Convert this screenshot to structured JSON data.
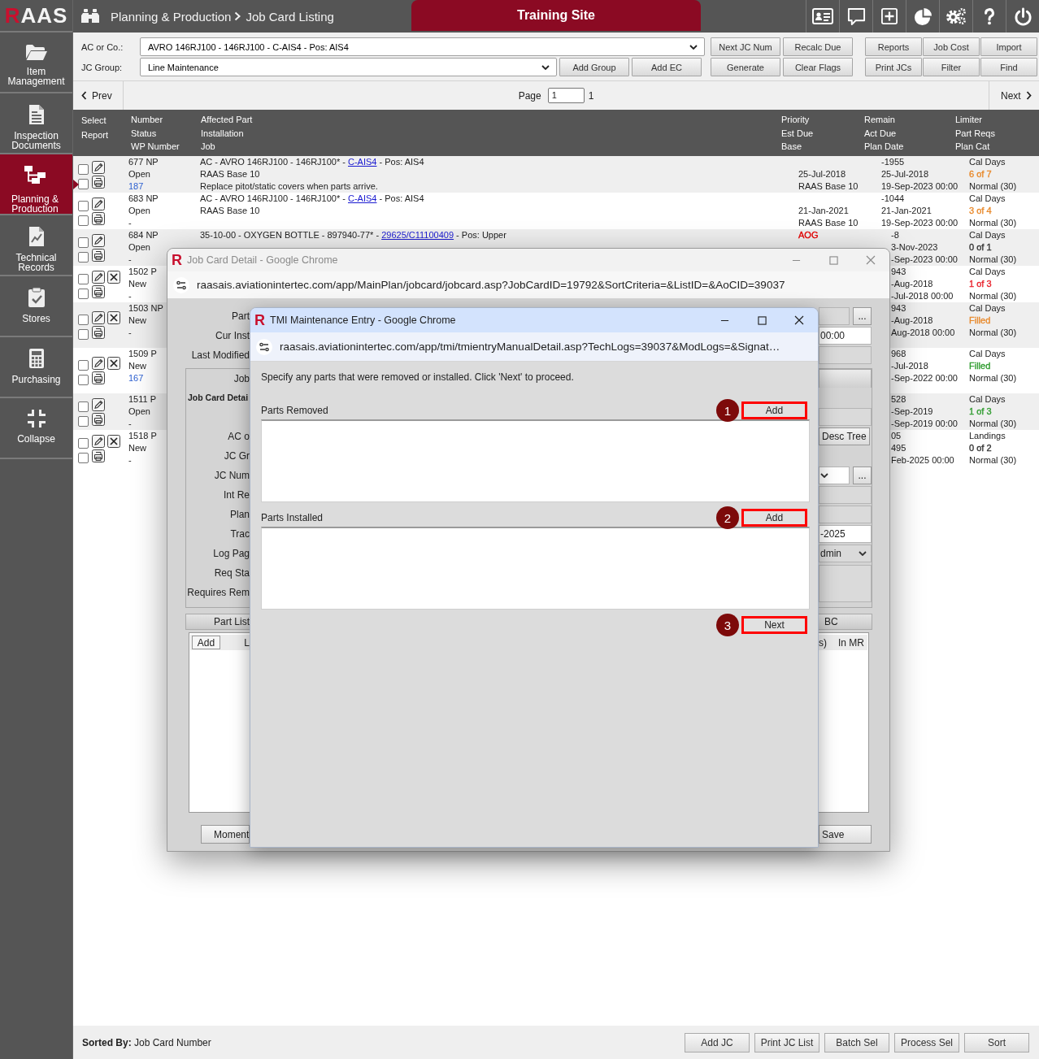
{
  "app": {
    "logo": "RAAS",
    "breadcrumb": [
      "Planning & Production",
      "Job Card Listing"
    ],
    "site_banner": "Training Site"
  },
  "sidebar": {
    "items": [
      {
        "label": "Item Management",
        "selected": false
      },
      {
        "label": "Inspection Documents",
        "selected": false
      },
      {
        "label": "Planning & Production",
        "selected": true
      },
      {
        "label": "Technical Records",
        "selected": false
      },
      {
        "label": "Stores",
        "selected": false
      },
      {
        "label": "Purchasing",
        "selected": false
      },
      {
        "label": "Collapse",
        "selected": false
      }
    ]
  },
  "filters": {
    "aircraft": {
      "label": "AC or Co.:",
      "value": "AVRO 146RJ100 - 146RJ100 - C-AIS4 - Pos: AIS4"
    },
    "group": {
      "label": "JC Group:",
      "value": "Line Maintenance",
      "buttons": [
        "Add Group",
        "Add EC"
      ]
    }
  },
  "action_buttons": [
    [
      "Next JC Num",
      "Recalc Due"
    ],
    [
      "Generate",
      "Clear Flags"
    ]
  ],
  "report_buttons": [
    [
      "Reports",
      "Job Cost",
      "Import"
    ],
    [
      "Print JCs",
      "Filter",
      "Find"
    ]
  ],
  "pager": {
    "prev": "Prev",
    "page_label": "Page",
    "page": "1",
    "page_count": "1",
    "next": "Next"
  },
  "table": {
    "columns": [
      [
        "Select",
        "Report"
      ],
      [
        "Number",
        "Status",
        "WP Number"
      ],
      [
        "Affected Part",
        "Installation",
        "Job"
      ],
      [
        "Priority",
        "Est Due",
        "Base"
      ],
      [
        "Remain",
        "Act Due",
        "Plan Date"
      ],
      [
        "Limiter",
        "Part Reqs",
        "Plan Cat"
      ]
    ],
    "rows": [
      {
        "number": "677 NP",
        "status": "Open",
        "wp": {
          "text": "187",
          "link": true
        },
        "part": {
          "before": "AC - AVRO 146RJ100 - 146RJ100* - ",
          "link": "C-AIS4",
          "after": " - Pos: AIS4"
        },
        "installation": "RAAS Base 10",
        "job": "Replace pitot/static covers when parts arrive.",
        "est_due": "25-Jul-2018",
        "base": "RAAS Base 10",
        "remain": "-1955",
        "act_due": "25-Jul-2018",
        "plan_date": "19-Sep-2023 00:00",
        "limiter": "Cal Days",
        "part_reqs": {
          "text": "6 of 7",
          "color": "#e8892b"
        },
        "plan_cat": "Normal (30)",
        "select_checked": false,
        "report_checked": false,
        "deletable": false
      },
      {
        "number": "683 NP",
        "status": "Open",
        "wp": {
          "text": "-",
          "link": false
        },
        "part": {
          "before": "AC - AVRO 146RJ100 - 146RJ100* - ",
          "link": "C-AIS4",
          "after": " - Pos: AIS4"
        },
        "installation": "RAAS Base 10",
        "est_due": "21-Jan-2021",
        "base": "RAAS Base 10",
        "remain": "-1044",
        "act_due": "21-Jan-2021",
        "plan_date": "19-Sep-2023 00:00",
        "limiter": "Cal Days",
        "part_reqs": {
          "text": "3 of 4",
          "color": "#e8892b"
        },
        "plan_cat": "Normal (30)",
        "select_checked": false,
        "report_checked": false,
        "deletable": false
      },
      {
        "number": "684 NP",
        "status": "Open",
        "wp": {
          "text": "-",
          "link": false
        },
        "part": {
          "before": "35-10-00 - OXYGEN BOTTLE - 897940-77* - ",
          "link": "29625/C11100409",
          "after": " - Pos: Upper"
        },
        "priority": {
          "text": "AOG",
          "color": "#e60000"
        },
        "remain": "-8",
        "act_due": "3-Nov-2023",
        "plan_date": "-Sep-2023 00:00",
        "limiter": "Cal Days",
        "part_reqs": {
          "text": "0 of 1",
          "color": "#333333"
        },
        "plan_cat": "Normal (30)",
        "select_checked": false,
        "report_checked": false,
        "deletable": false
      },
      {
        "number": "1502 P",
        "status": "New",
        "wp": {
          "text": "-",
          "link": false
        },
        "remain": "943",
        "act_due": "-Aug-2018",
        "plan_date": "-Jul-2018 00:00",
        "limiter": "Cal Days",
        "part_reqs": {
          "text": "1 of 3",
          "color": "#e8202a"
        },
        "plan_cat": "Normal (30)",
        "select_checked": false,
        "report_checked": false,
        "deletable": true
      },
      {
        "number": "1503 NP",
        "status": "New",
        "wp": {
          "text": "-",
          "link": false
        },
        "remain": "943",
        "act_due": "-Aug-2018",
        "plan_date": "Aug-2018 00:00",
        "limiter": "Cal Days",
        "part_reqs": {
          "text": "Filled",
          "color": "#e8892b"
        },
        "plan_cat": "Normal (30)",
        "select_checked": false,
        "report_checked": false,
        "deletable": true
      },
      {
        "number": "1509 P",
        "status": "New",
        "wp": {
          "text": "167",
          "link": true
        },
        "remain": "968",
        "act_due": "-Jul-2018",
        "plan_date": "-Sep-2022 00:00",
        "limiter": "Cal Days",
        "part_reqs": {
          "text": "Filled",
          "color": "#2e9b2e"
        },
        "plan_cat": "Normal (30)",
        "select_checked": false,
        "report_checked": false,
        "deletable": true
      },
      {
        "number": "1511 P",
        "status": "Open",
        "wp": {
          "text": "-",
          "link": false
        },
        "remain": "528",
        "act_due": "-Sep-2019",
        "plan_date": "-Sep-2019 00:00",
        "limiter": "Cal Days",
        "part_reqs": {
          "text": "1 of 3",
          "color": "#2e9b2e"
        },
        "plan_cat": "Normal (30)",
        "select_checked": false,
        "report_checked": false,
        "deletable": false
      },
      {
        "number": "1518 P",
        "status": "New",
        "wp": {
          "text": "-",
          "link": false
        },
        "remain": "05",
        "act_due": "495",
        "plan_date": "Feb-2025 00:00",
        "limiter": "Landings",
        "part_reqs": {
          "text": "0 of 2",
          "color": "#333333"
        },
        "plan_cat": "Normal (30)",
        "select_checked": false,
        "report_checked": false,
        "deletable": true
      }
    ]
  },
  "job_card_window": {
    "app_icon": "R",
    "title": "Job Card Detail - Google Chrome",
    "active": false,
    "url": "raasais.aviationintertec.com/app/MainPlan/jobcard/jobcard.asp?JobCardID=19792&SortCriteria=&ListID=&AoCID=39037",
    "fields": [
      {
        "label": "Part",
        "control": {
          "kind": "lookup",
          "button": "..."
        }
      },
      {
        "label": "Cur Inst",
        "control": {
          "kind": "input",
          "value": "00:00"
        }
      },
      {
        "label": "Last Modified",
        "control": {
          "kind": "readonly"
        }
      }
    ],
    "panel": {
      "header": "Job",
      "rows": [
        {
          "kind": "section",
          "label": "Job Card Detai"
        },
        {
          "kind": "field",
          "control": {
            "kind": "readonly"
          }
        },
        {
          "kind": "field",
          "label": "AC o",
          "control": {
            "kind": "button",
            "text": "Desc Tree"
          }
        },
        {
          "kind": "field",
          "label": "JC Gr"
        },
        {
          "kind": "field",
          "label": "JC Num",
          "control": {
            "kind": "lookup_select",
            "button": "..."
          }
        },
        {
          "kind": "field",
          "label": "Int Re",
          "control": {
            "kind": "readonly"
          }
        },
        {
          "kind": "field",
          "label": "Plan",
          "control": {
            "kind": "readonly"
          }
        },
        {
          "kind": "field",
          "label": "Trac",
          "control": {
            "kind": "input",
            "value": "-2025"
          }
        },
        {
          "kind": "field",
          "label": "Log Pag",
          "control": {
            "kind": "select",
            "value": "dmin"
          }
        },
        {
          "kind": "field",
          "label": "Req Sta",
          "control": {
            "kind": "textarea"
          }
        },
        {
          "kind": "field",
          "label": "Requires Rem"
        }
      ]
    },
    "part_list": {
      "title": "Part List",
      "title_right": "BC",
      "add_button": "Add",
      "left_columns": [
        "L"
      ],
      "right_columns": [
        "s)",
        "In MR"
      ]
    },
    "left_button": "Moment",
    "right_button": "Save"
  },
  "tmi_window": {
    "app_icon": "R",
    "title": "TMI Maintenance Entry - Google Chrome",
    "active": true,
    "url": "raasais.aviationintertec.com/app/tmi/tmientryManualDetail.asp?TechLogs=39037&ModLogs=&Signat…",
    "instruction": "Specify any parts that were removed or installed. Click 'Next' to proceed.",
    "sections": [
      {
        "label": "Parts Removed",
        "button": "Add",
        "step": "1",
        "highlighted": true
      },
      {
        "label": "Parts Installed",
        "button": "Add",
        "step": "2",
        "highlighted": true
      }
    ],
    "next": {
      "button": "Next",
      "step": "3",
      "highlighted": true
    }
  },
  "footer": {
    "sorted_by": "**Sorted By:** Job Card Number",
    "buttons": [
      "Add JC",
      "Print JC List",
      "Batch Sel",
      "Process Sel",
      "Sort"
    ]
  }
}
